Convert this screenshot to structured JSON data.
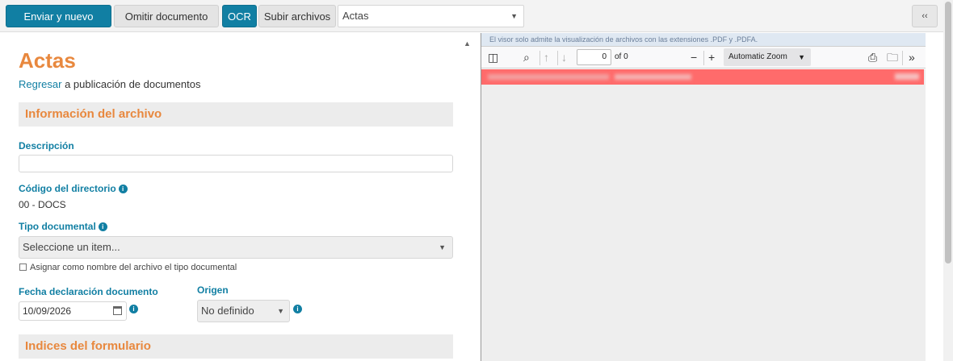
{
  "toolbar": {
    "send_new": "Enviar y nuevo",
    "skip_document": "Omitir documento",
    "ocr": "OCR",
    "upload_files": "Subir archivos",
    "document_type_select": "Actas",
    "collapse": "‹‹"
  },
  "form": {
    "title": "Actas",
    "back_link": "Regresar",
    "back_text": " a publicación de documentos",
    "section_file_info": "Información del archivo",
    "description_label": "Descripción",
    "description_value": "",
    "directory_code_label": "Código del directorio",
    "directory_code_value": "00 - DOCS",
    "doc_type_label": "Tipo documental",
    "doc_type_value": "Seleccione un item...",
    "assign_name_label": "Asignar como nombre del archivo el tipo documental",
    "declaration_date_label": "Fecha declaración documento",
    "declaration_date_value": "10/09/2026",
    "origin_label": "Origen",
    "origin_value": "No definido",
    "section_form_indices": "Indices del formulario"
  },
  "viewer": {
    "notice": "El visor solo admite la visualización de archivos con las extensiones .PDF y .PDFA.",
    "page_number": "0",
    "page_of": "of 0",
    "zoom": "Automatic Zoom"
  },
  "colors": {
    "primary": "#117fa3",
    "accent": "#e8883e",
    "error": "#ff6b6b"
  }
}
